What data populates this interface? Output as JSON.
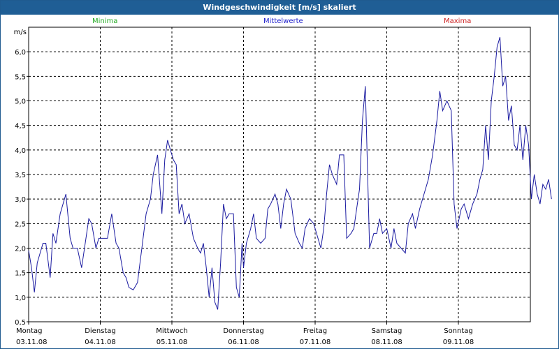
{
  "window": {
    "title": "Windgeschwindigkeit [m/s] skaliert"
  },
  "legend": {
    "min": {
      "label": "Minima",
      "color": "#22aa22"
    },
    "mean": {
      "label": "Mittelwerte",
      "color": "#2222cc"
    },
    "max": {
      "label": "Maxima",
      "color": "#cc2222"
    }
  },
  "chart_data": {
    "type": "line",
    "title": "Windgeschwindigkeit [m/s] skaliert",
    "ylabel": "m/s",
    "xlabel": "",
    "ylim": [
      0.5,
      6.5
    ],
    "yticks": [
      0.5,
      1.0,
      1.5,
      2.0,
      2.5,
      3.0,
      3.5,
      4.0,
      4.5,
      5.0,
      5.5,
      6.0
    ],
    "ytick_labels": [
      "0,5",
      "1,0",
      "1,5",
      "2,0",
      "2,5",
      "3,0",
      "3,5",
      "4,0",
      "4,5",
      "5,0",
      "5,5",
      "6,0"
    ],
    "xlim": [
      0,
      7
    ],
    "x_unit": "days from 03.11.08 00:00",
    "x_ticks": [
      {
        "day": "Montag",
        "date": "03.11.08"
      },
      {
        "day": "Dienstag",
        "date": "04.11.08"
      },
      {
        "day": "Mittwoch",
        "date": "05.11.08"
      },
      {
        "day": "Donnerstag",
        "date": "06.11.08"
      },
      {
        "day": "Freitag",
        "date": "07.11.08"
      },
      {
        "day": "Samstag",
        "date": "08.11.08"
      },
      {
        "day": "Sonntag",
        "date": "09.11.08"
      }
    ],
    "grid": true,
    "series": [
      {
        "name": "Mittelwerte",
        "color": "#1a1aa0",
        "points": [
          [
            0.0,
            1.95
          ],
          [
            0.04,
            1.6
          ],
          [
            0.08,
            1.1
          ],
          [
            0.12,
            1.7
          ],
          [
            0.2,
            2.1
          ],
          [
            0.24,
            2.1
          ],
          [
            0.3,
            1.4
          ],
          [
            0.34,
            2.3
          ],
          [
            0.38,
            2.1
          ],
          [
            0.44,
            2.7
          ],
          [
            0.48,
            2.9
          ],
          [
            0.52,
            3.1
          ],
          [
            0.58,
            2.2
          ],
          [
            0.62,
            2.0
          ],
          [
            0.68,
            2.0
          ],
          [
            0.74,
            1.6
          ],
          [
            0.8,
            2.2
          ],
          [
            0.84,
            2.6
          ],
          [
            0.88,
            2.5
          ],
          [
            0.94,
            2.0
          ],
          [
            0.98,
            2.2
          ],
          [
            1.04,
            2.2
          ],
          [
            1.1,
            2.2
          ],
          [
            1.16,
            2.7
          ],
          [
            1.22,
            2.1
          ],
          [
            1.26,
            2.0
          ],
          [
            1.32,
            1.5
          ],
          [
            1.36,
            1.4
          ],
          [
            1.4,
            1.2
          ],
          [
            1.46,
            1.15
          ],
          [
            1.52,
            1.3
          ],
          [
            1.58,
            2.0
          ],
          [
            1.64,
            2.7
          ],
          [
            1.7,
            3.0
          ],
          [
            1.74,
            3.5
          ],
          [
            1.8,
            3.9
          ],
          [
            1.86,
            2.7
          ],
          [
            1.9,
            3.8
          ],
          [
            1.94,
            4.2
          ],
          [
            1.98,
            4.0
          ],
          [
            2.02,
            3.8
          ],
          [
            2.06,
            3.7
          ],
          [
            2.1,
            2.7
          ],
          [
            2.14,
            2.9
          ],
          [
            2.18,
            2.5
          ],
          [
            2.24,
            2.7
          ],
          [
            2.3,
            2.2
          ],
          [
            2.36,
            2.0
          ],
          [
            2.4,
            1.9
          ],
          [
            2.44,
            2.1
          ],
          [
            2.48,
            1.6
          ],
          [
            2.52,
            1.0
          ],
          [
            2.56,
            1.6
          ],
          [
            2.6,
            0.9
          ],
          [
            2.64,
            0.75
          ],
          [
            2.68,
            1.7
          ],
          [
            2.72,
            2.9
          ],
          [
            2.76,
            2.6
          ],
          [
            2.8,
            2.7
          ],
          [
            2.86,
            2.7
          ],
          [
            2.9,
            1.2
          ],
          [
            2.94,
            1.0
          ],
          [
            2.98,
            2.1
          ],
          [
            3.0,
            1.6
          ],
          [
            3.04,
            2.1
          ],
          [
            3.1,
            2.4
          ],
          [
            3.14,
            2.7
          ],
          [
            3.18,
            2.2
          ],
          [
            3.24,
            2.1
          ],
          [
            3.3,
            2.2
          ],
          [
            3.34,
            2.8
          ],
          [
            3.38,
            2.9
          ],
          [
            3.44,
            3.1
          ],
          [
            3.48,
            2.9
          ],
          [
            3.52,
            2.4
          ],
          [
            3.56,
            2.9
          ],
          [
            3.6,
            3.2
          ],
          [
            3.66,
            3.0
          ],
          [
            3.72,
            2.3
          ],
          [
            3.78,
            2.1
          ],
          [
            3.82,
            2.0
          ],
          [
            3.86,
            2.4
          ],
          [
            3.92,
            2.6
          ],
          [
            3.98,
            2.5
          ],
          [
            4.02,
            2.3
          ],
          [
            4.08,
            2.0
          ],
          [
            4.12,
            2.4
          ],
          [
            4.16,
            3.1
          ],
          [
            4.2,
            3.7
          ],
          [
            4.24,
            3.5
          ],
          [
            4.3,
            3.3
          ],
          [
            4.34,
            3.9
          ],
          [
            4.4,
            3.9
          ],
          [
            4.44,
            2.2
          ],
          [
            4.5,
            2.3
          ],
          [
            4.54,
            2.4
          ],
          [
            4.58,
            2.8
          ],
          [
            4.62,
            3.2
          ],
          [
            4.66,
            4.6
          ],
          [
            4.7,
            5.3
          ],
          [
            4.76,
            2.0
          ],
          [
            4.82,
            2.3
          ],
          [
            4.86,
            2.3
          ],
          [
            4.9,
            2.6
          ],
          [
            4.94,
            2.3
          ],
          [
            5.0,
            2.4
          ],
          [
            5.06,
            2.0
          ],
          [
            5.1,
            2.4
          ],
          [
            5.14,
            2.1
          ],
          [
            5.2,
            2.0
          ],
          [
            5.26,
            1.9
          ],
          [
            5.3,
            2.5
          ],
          [
            5.36,
            2.7
          ],
          [
            5.4,
            2.4
          ],
          [
            5.46,
            2.8
          ],
          [
            5.52,
            3.1
          ],
          [
            5.58,
            3.4
          ],
          [
            5.64,
            3.9
          ],
          [
            5.7,
            4.6
          ],
          [
            5.74,
            5.2
          ],
          [
            5.78,
            4.8
          ],
          [
            5.84,
            5.0
          ],
          [
            5.9,
            4.8
          ],
          [
            5.94,
            2.9
          ],
          [
            5.98,
            2.4
          ],
          [
            6.04,
            2.8
          ],
          [
            6.08,
            2.9
          ],
          [
            6.14,
            2.6
          ],
          [
            6.2,
            2.9
          ],
          [
            6.26,
            3.1
          ],
          [
            6.3,
            3.4
          ],
          [
            6.34,
            3.6
          ],
          [
            6.38,
            4.5
          ],
          [
            6.42,
            3.8
          ],
          [
            6.46,
            5.0
          ],
          [
            6.5,
            5.5
          ],
          [
            6.54,
            6.1
          ],
          [
            6.58,
            6.3
          ],
          [
            6.62,
            5.3
          ],
          [
            6.66,
            5.5
          ],
          [
            6.7,
            4.6
          ],
          [
            6.74,
            4.9
          ],
          [
            6.78,
            4.1
          ],
          [
            6.82,
            4.0
          ],
          [
            6.86,
            4.5
          ],
          [
            6.9,
            3.8
          ],
          [
            6.94,
            4.5
          ],
          [
            6.98,
            4.1
          ],
          [
            7.02,
            3.0
          ],
          [
            7.06,
            3.5
          ],
          [
            7.1,
            3.1
          ],
          [
            7.14,
            2.9
          ],
          [
            7.18,
            3.3
          ],
          [
            7.22,
            3.2
          ],
          [
            7.26,
            3.4
          ],
          [
            7.3,
            3.0
          ]
        ]
      }
    ]
  }
}
